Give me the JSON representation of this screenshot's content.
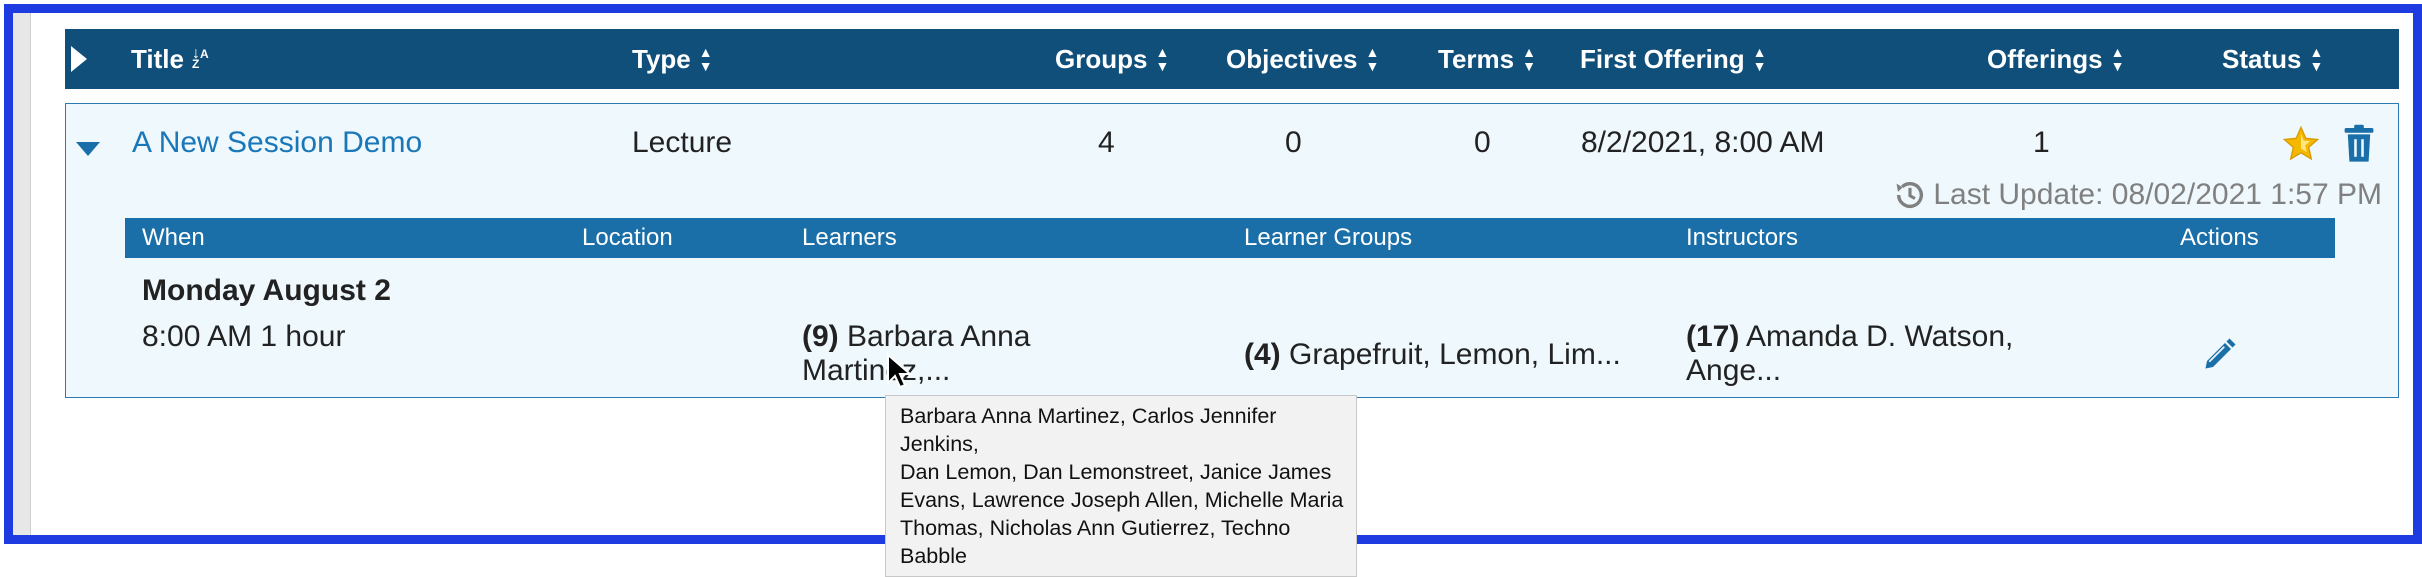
{
  "columns": {
    "title": "Title",
    "type": "Type",
    "groups": "Groups",
    "objectives": "Objectives",
    "terms": "Terms",
    "first_offering": "First Offering",
    "offerings": "Offerings",
    "status": "Status"
  },
  "session": {
    "title": "A New Session Demo",
    "type": "Lecture",
    "groups": "4",
    "objectives": "0",
    "terms": "0",
    "first_offering": "8/2/2021, 8:00 AM",
    "offerings": "1",
    "last_update": "Last Update: 08/02/2021 1:57 PM"
  },
  "offerings_table": {
    "headers": {
      "when": "When",
      "location": "Location",
      "learners": "Learners",
      "learner_groups": "Learner Groups",
      "instructors": "Instructors",
      "actions": "Actions"
    },
    "date": "Monday August 2",
    "offering": {
      "time": "8:00 AM 1 hour",
      "learners_count": "(9)",
      "learners_line1": "Barbara Anna",
      "learners_line2": "Martinez,...",
      "groups_count": "(4)",
      "groups_text": "Grapefruit, Lemon, Lim...",
      "instructors_count": "(17)",
      "instructors_line1": "Amanda D. Watson,",
      "instructors_line2": "Ange..."
    }
  },
  "tooltip": {
    "lines": [
      "Barbara Anna Martinez, Carlos Jennifer Jenkins,",
      "Dan Lemon, Dan Lemonstreet, Janice James",
      "Evans, Lawrence Joseph Allen, Michelle Maria",
      "Thomas, Nicholas Ann Gutierrez, Techno Babble"
    ]
  },
  "colors": {
    "frame": "#1d3be0",
    "header": "#0f4f7a",
    "subheader": "#1a6fa8",
    "link": "#1a77b8",
    "star": "#f5b800",
    "trash": "#1a6fa8"
  },
  "icons": [
    "expand-all-icon",
    "collapse-icon",
    "star-icon",
    "trash-icon",
    "history-icon",
    "pencil-icon",
    "mouse-cursor-icon"
  ]
}
